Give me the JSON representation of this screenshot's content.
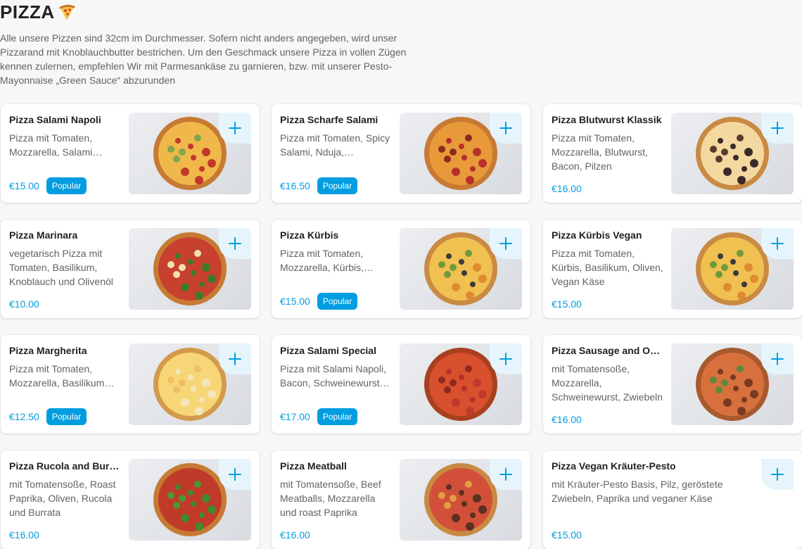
{
  "section": {
    "title": "PIZZA",
    "description": "Alle unsere Pizzen sind 32cm im Durchmesser. Sofern nicht anders angegeben, wird unser Pizzarand mit Knoblauchbutter bestrichen. Um den Geschmack unsere Pizza in vollen Zügen kennen zulernen, empfehlen Wir mit Parmesankäse zu garnieren, bzw. mit unserer Pesto-Mayonnaise „Green Sauce“ abzurunden"
  },
  "colors": {
    "accent": "#009de0",
    "add_button_bg": "#e6f5fc"
  },
  "items": [
    {
      "name": "Pizza Salami Napoli",
      "description": "Pizza mit Tomaten, Mozzarella, Salami Napoli",
      "price": "€15.00",
      "badge": "Popular",
      "icon": "plus-icon"
    },
    {
      "name": "Pizza Scharfe Salami",
      "description": "Pizza mit Tomaten, Spicy Salami, Nduja, Mozzarella",
      "price": "€16.50",
      "badge": "Popular",
      "icon": "plus-icon"
    },
    {
      "name": "Pizza Blutwurst Klassik",
      "description": "Pizza mit Tomaten, Mozzarella, Blutwurst, Bacon, Pilzen",
      "price": "€16.00",
      "badge": "",
      "icon": "plus-icon"
    },
    {
      "name": "Pizza Marinara",
      "description": "vegetarisch Pizza mit Tomaten, Basilikum, Knoblauch und Olivenöl",
      "price": "€10.00",
      "badge": "",
      "icon": "plus-icon"
    },
    {
      "name": "Pizza Kürbis",
      "description": "Pizza mit Tomaten, Mozzarella, Kürbis, Basilikum",
      "price": "€15.00",
      "badge": "Popular",
      "icon": "plus-icon"
    },
    {
      "name": "Pizza Kürbis Vegan",
      "description": "Pizza mit Tomaten, Kürbis, Basilikum, Oliven, Vegan Käse",
      "price": "€15.00",
      "badge": "",
      "icon": "plus-icon"
    },
    {
      "name": "Pizza Margherita",
      "description": "Pizza mit Tomaten, Mozzarella, Basilikum und Olivenöl",
      "price": "€12.50",
      "badge": "Popular",
      "icon": "plus-icon"
    },
    {
      "name": "Pizza Salami Special",
      "description": "Pizza mit Salami Napoli, Bacon, Schweinewurst und Mozzarella",
      "price": "€17.00",
      "badge": "Popular",
      "icon": "plus-icon"
    },
    {
      "name": "Pizza Sausage and Onion",
      "description": "mit Tomatensoße, Mozzarella, Schweinewurst, Zwiebeln",
      "price": "€16.00",
      "badge": "",
      "icon": "plus-icon"
    },
    {
      "name": "Pizza Rucola and Burrata",
      "description": "mit Tomatensoße, Roast Paprika, Oliven, Rucola und Burrata",
      "price": "€16.00",
      "badge": "",
      "icon": "plus-icon"
    },
    {
      "name": "Pizza Meatball",
      "description": "mit Tomatensoße, Beef Meatballs, Mozzarella und roast Paprika",
      "price": "€16.00",
      "badge": "",
      "icon": "plus-icon"
    },
    {
      "name": "Pizza Vegan Kräuter-Pesto",
      "description": "mit Kräuter-Pesto Basis, Pilz, geröstete Zwiebeln, Paprika und veganer Käse",
      "price": "€15.00",
      "badge": "",
      "icon": "plus-icon"
    }
  ]
}
